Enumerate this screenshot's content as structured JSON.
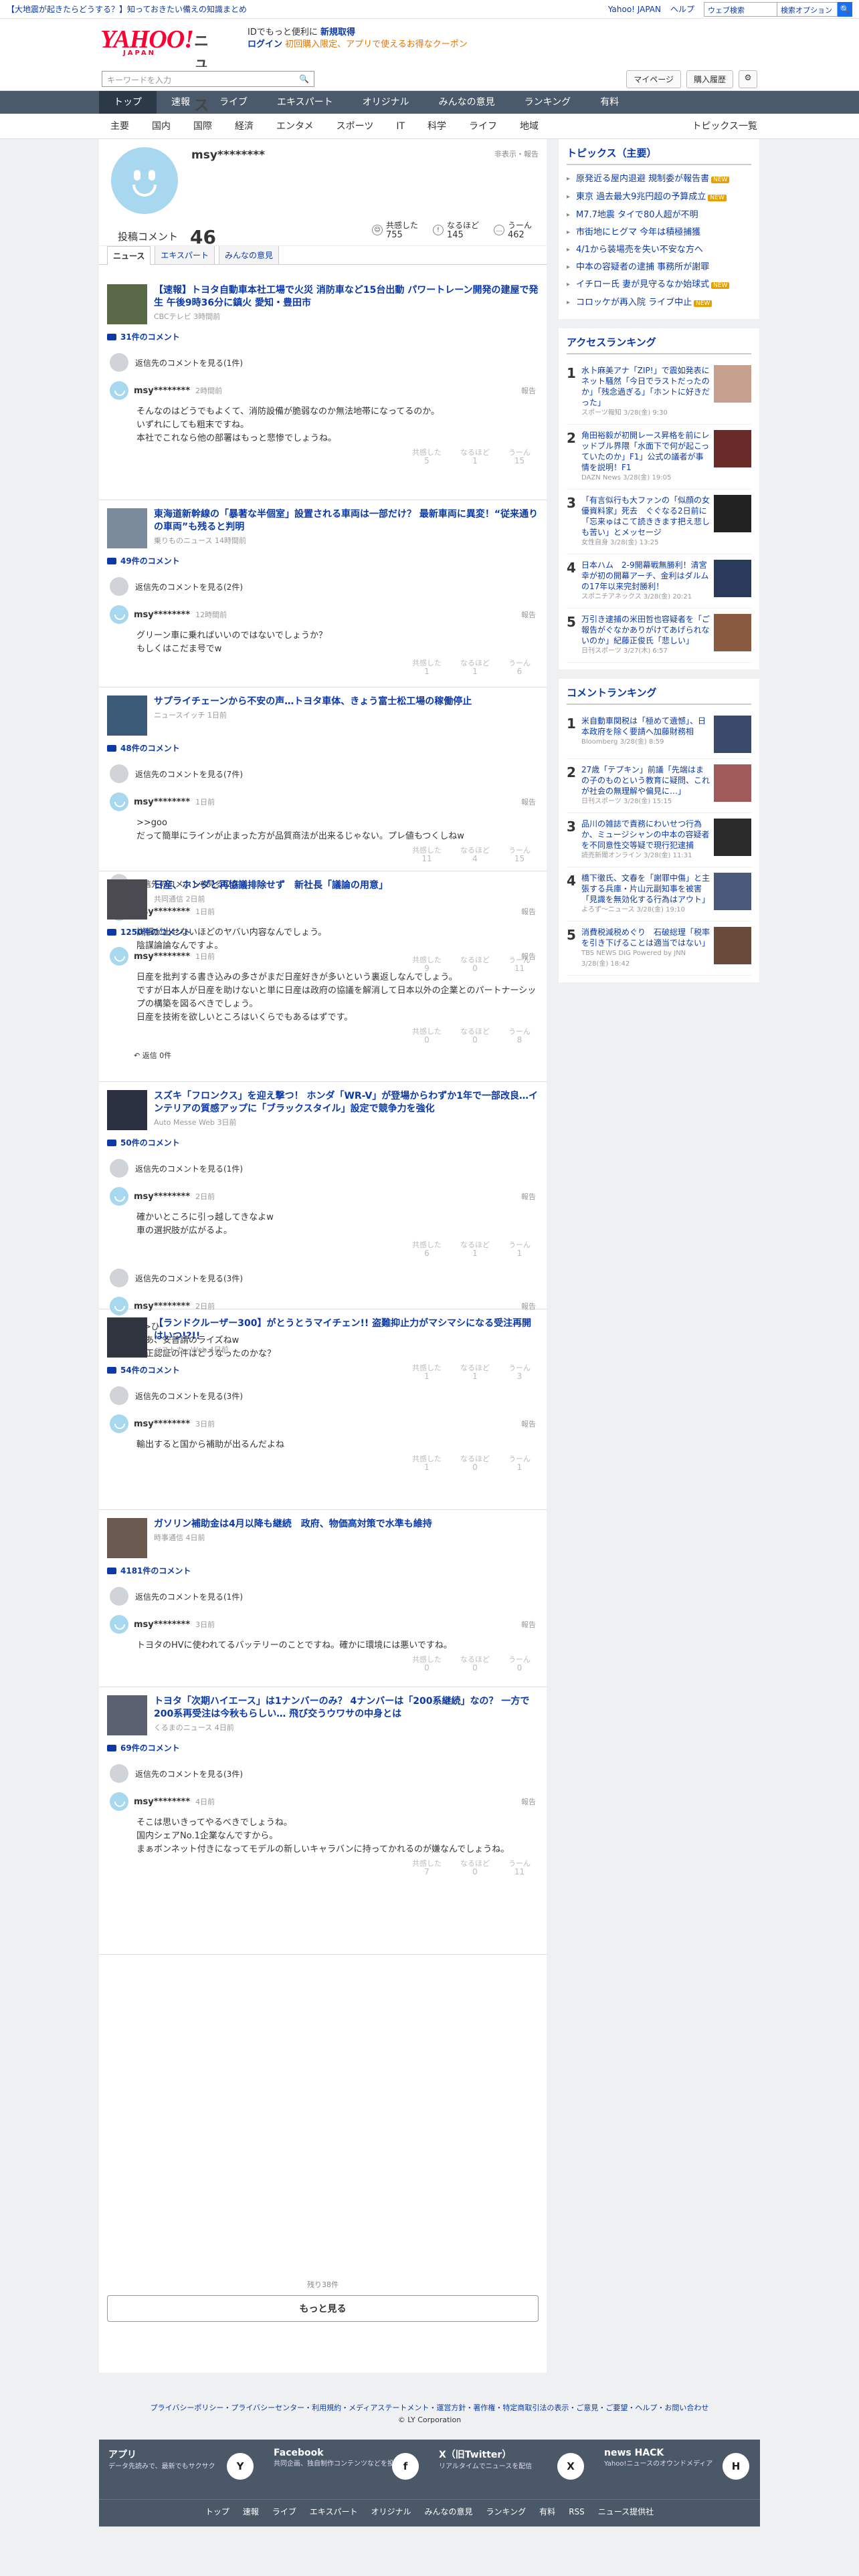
{
  "topbar": {
    "promo": "【大地震が起きたらどうする？】知っておきたい備えの知識まとめ",
    "yahoo_japan": "Yahoo! JAPAN",
    "help": "ヘルプ",
    "search_placeholder": "ウェブ検索",
    "search_value": "検索オプション",
    "search_btn": "🔍"
  },
  "header": {
    "logo": "YAHOO!",
    "logo_sub": "JAPAN",
    "service": "ニュース",
    "msg1": "IDでもっと便利に",
    "msg1_link": "新規取得",
    "login": "ログイン",
    "coupon": "初回購入限定、アプリで使えるお得なクーポン",
    "keyword_placeholder": "キーワードを入力",
    "mypage": "マイページ",
    "history": "購入履歴",
    "gear": "⚙"
  },
  "gnav": [
    "トップ",
    "速報",
    "ライブ",
    "エキスパート",
    "オリジナル",
    "みんなの意見",
    "ランキング",
    "有料"
  ],
  "snav": [
    "主要",
    "国内",
    "国際",
    "経済",
    "エンタメ",
    "スポーツ",
    "IT",
    "科学",
    "ライフ",
    "地域"
  ],
  "snav_all": "トピックス一覧",
  "profile": {
    "name": "msy********",
    "report": "非表示・報告",
    "count_label": "投稿コメント",
    "count": "46",
    "stats": [
      {
        "label": "共感した",
        "num": "755",
        "ic": "☺"
      },
      {
        "label": "なるほど",
        "num": "145",
        "ic": "!"
      },
      {
        "label": "うーん",
        "num": "462",
        "ic": "…"
      }
    ]
  },
  "tabs": [
    "ニュース",
    "エキスパート",
    "みんなの意見"
  ],
  "articles": [
    {
      "title": "【速報】トヨタ自動車本社工場で火災 消防車など15台出動 パワートレーン開発の建屋で発生 午後9時36分に鎮火 愛知・豊田市",
      "src": "CBCテレビ 3時間前",
      "count": "31件のコメント",
      "orig": "返信先のコメントを見る(1件)",
      "user": "msy********",
      "time": "2時間前",
      "text": "そんなのはどうでもよくて、消防設備が脆弱なのか無法地帯になってるのか。\nいずれにしても粗末ですね。\n本社でこれなら他の部署はもっと悲惨でしょうね。",
      "r": [
        "5",
        "1",
        "15"
      ],
      "thumb": "#5a6a48"
    },
    {
      "title": "東海道新幹線の「暴著な半個室」設置される車両は一部だけ？ 最新車両に異変！“従来通りの車両”も残ると判明",
      "src": "乗りものニュース 14時間前",
      "count": "49件のコメント",
      "orig": "返信先のコメントを見る(2件)",
      "user": "msy********",
      "time": "12時間前",
      "text": "グリーン車に乗ればいいのではないでしょうか？\nもしくはこだま号でw",
      "r": [
        "1",
        "1",
        "6"
      ],
      "thumb": "#7a8a9a"
    },
    {
      "title": "サプライチェーンから不安の声…トヨタ車体、きょう富士松工場の稼働停止",
      "src": "ニュースイッチ 1日前",
      "count": "48件のコメント",
      "orig": "返信先のコメントを見る(7件)",
      "user": "msy********",
      "time": "1日前",
      "text": ">>goo\nだって簡単にラインが止まった方が品質商法が出来るじゃない。プレ値もつくしねw",
      "r": [
        "11",
        "4",
        "15"
      ],
      "thumb": "#3a5a78",
      "user2": "msy********",
      "time2": "1日前",
      "orig2": "返信先のコメントを見る(2件)",
      "text2": "詳細が出せないほどのヤバい内容なんでしょう。\n陰謀論論なんですよ。",
      "r2": [
        "9",
        "0",
        "11"
      ]
    },
    {
      "title": "日産、ホンダと再協議排除せず　新社長「議論の用意」",
      "src": "共同通信 2日前",
      "count": "1250件のコメント",
      "user": "msy********",
      "time": "1日前",
      "text": "日産を批判する書き込みの多さがまだ日産好きが多いという裏返しなんでしょう。\nですが日本人が日産を助けないと単に日産は政府の協議を解消して日本以外の企業とのパートナーシップの構築を図るべきでしょう。\n日産を技術を欲しいところはいくらでもあるはずです。",
      "r": [
        "0",
        "0",
        "8"
      ],
      "reply": "返信 0件",
      "thumb": "#4a4a50"
    },
    {
      "title": "スズキ「フロンクス」を迎え撃つ！ ホンダ「WR-V」が登場からわずか1年で一部改良…インテリアの質感アップに「ブラックスタイル」設定で競争力を強化",
      "src": "Auto Messe Web 3日前",
      "count": "50件のコメント",
      "orig": "返信先のコメントを見る(1件)",
      "user": "msy********",
      "time": "2日前",
      "text": "確かいところに引っ越してきなよw\n車の選択肢が広がるよ。",
      "r": [
        "6",
        "1",
        "1"
      ],
      "thumb": "#2a3040",
      "user2": "msy********",
      "time2": "2日前",
      "orig2": "返信先のコメントを見る(3件)",
      "text2": ">>ひ\nああ、安普請のライズねw\n不正認証の件はどうなったのかな？",
      "r2": [
        "1",
        "1",
        "3"
      ]
    },
    {
      "title": "【ランドクルーザー300】がとうとうマイチェン!! 盗難抑止力がマシマシになる受注再開はいつ!?!!",
      "src": "ベストカーWeb 4日前",
      "count": "54件のコメント",
      "orig": "返信先のコメントを見る(3件)",
      "user": "msy********",
      "time": "3日前",
      "text": "輸出すると国から補助が出るんだよね",
      "r": [
        "1",
        "0",
        "1"
      ],
      "thumb": "#303540"
    },
    {
      "title": "ガソリン補助金は4月以降も継続　政府、物価高対策で水準も維持",
      "src": "時事通信 4日前",
      "count": "4181件のコメント",
      "orig": "返信先のコメントを見る(1件)",
      "user": "msy********",
      "time": "3日前",
      "text": "トヨタのHVに使われてるバッテリーのことですね。確かに環境には悪いですね。",
      "r": [
        "0",
        "0",
        "0"
      ],
      "thumb": "#6a5a50"
    },
    {
      "title": "トヨタ「次期ハイエース」は1ナンバーのみ？ 4ナンバーは「200系継続」なの？ 一方で200系再受注は今秋もらしい… 飛び交うウワサの中身とは",
      "src": "くるまのニュース 4日前",
      "count": "69件のコメント",
      "orig": "返信先のコメントを見る(3件)",
      "user": "msy********",
      "time": "4日前",
      "text": "そこは思いきってやるべきでしょうね。\n国内シェアNo.1企業なんですから。\nまぁボンネット付きになってモデルの新しいキャラバンに持ってかれるのが嫌なんでしょうね。",
      "r": [
        "7",
        "0",
        "11"
      ],
      "thumb": "#5a6070"
    }
  ],
  "more": {
    "remain": "残り38件",
    "button": "もっと見る"
  },
  "topics": {
    "title": "トピックス（主要）",
    "items": [
      {
        "t": "原発近る屋内退避 規制委が報告書",
        "n": "NEW"
      },
      {
        "t": "東京 過去最大9兆円超の予算成立",
        "n": "NEW"
      },
      {
        "t": "M7.7地震 タイで80人超が不明",
        "n": ""
      },
      {
        "t": "市街地にヒグマ 今年は積極捕獲",
        "n": ""
      },
      {
        "t": "4/1から装場売を失い不安な方へ",
        "n": ""
      },
      {
        "t": "中本の容疑者の逮捕 事務所が謝罪",
        "n": ""
      },
      {
        "t": "イチロー氏 妻が見守るなか始球式",
        "n": "NEW"
      },
      {
        "t": "コロッケが再入院 ライブ中止",
        "n": "NEW"
      }
    ]
  },
  "access": {
    "title": "アクセスランキング",
    "items": [
      {
        "no": "1",
        "t": "水卜麻美アナ「ZIP!」で震如発表にネット騒然「今日でラストだったのか」「残念過ぎる」「ホントに好きだった」",
        "s": "スポーツ報知 3/28(金) 9:30",
        "c": "#c8a090"
      },
      {
        "no": "2",
        "t": "角田裕毅が初開レース昇格を前にレッドブル界隈「水面下で何が起こっていたのか」F1」公式の議者が事情を説明！F1",
        "s": "DAZN News 3/28(金) 19:05",
        "c": "#6a2a2a"
      },
      {
        "no": "3",
        "t": "「有言似行も大ファンの「似顔の女優資料家」死去　ぐぐなる2日前に「忘来ゅはこて読ききます把え悲しも苦い」とメッセージ",
        "s": "女性自身 3/28(金) 13:25",
        "c": "#222"
      },
      {
        "no": "4",
        "t": "日本ハム　2-9開幕戦無勝利！清宮幸が初の開幕アーチ、金利はダルムの17年以来完封勝利！",
        "s": "スポニチアネックス 3/28(金) 20:21",
        "c": "#2a3a5a"
      },
      {
        "no": "5",
        "t": "万引き逮捕の米田哲也容疑者を「ご報告がぐなかありがけてあげられないのか」紀藤正俊氏「悲しい」",
        "s": "日刊スポーツ 3/27(木) 6:57",
        "c": "#8a5a40"
      }
    ]
  },
  "comment_rank": {
    "title": "コメントランキング",
    "items": [
      {
        "no": "1",
        "t": "米自動車関税は「極めて遺憾」、日本政府を除く要請へ加藤財務相",
        "s": "Bloomberg 3/28(金) 8:59",
        "c": "#3a4a6a"
      },
      {
        "no": "2",
        "t": "27歳「テプキン」前議「先端はまの子のものという教育に疑問、これが社会の無理解や偏見に…」",
        "s": "日刊スポーツ 3/28(金) 15:15",
        "c": "#a05a5a"
      },
      {
        "no": "3",
        "t": "品川の雑誌で責務にわいせつ行為か、ミュージシャンの中本の容疑者を不同意性交等疑で現行犯逮捕",
        "s": "読売新聞オンライン 3/28(金) 11:31",
        "c": "#2a2a2a"
      },
      {
        "no": "4",
        "t": "橋下徹氏、文春を「謝罪中傷」と主張する兵庫・片山元副知事を被害「見識を無効化する行為はアウト」",
        "s": "よろず〜ニュース 3/28(金) 19:10",
        "c": "#4a5a7a"
      },
      {
        "no": "5",
        "t": "消費税減税めぐり　石破総理「税率を引き下げることは適当ではない」",
        "s": "TBS NEWS DIG Powered by JNN 3/28(金) 18:42",
        "c": "#6a4a3a"
      }
    ]
  },
  "footer": {
    "apps": [
      {
        "n": "アプリ",
        "d": "データ先読みで、最新でもサクサク",
        "i": "Y"
      },
      {
        "n": "Facebook",
        "d": "共同企画、独自制作コンテンツなどを投稿",
        "i": "f"
      },
      {
        "n": "X（旧Twitter）",
        "d": "リアルタイムでニュースを配信",
        "i": "X"
      },
      {
        "n": "news HACK",
        "d": "Yahoo!ニュースのオウンドメディア",
        "i": "H"
      }
    ],
    "links": [
      "トップ",
      "速報",
      "ライブ",
      "エキスパート",
      "オリジナル",
      "みんなの意見",
      "ランキング",
      "有料",
      "RSS",
      "ニュース提供社"
    ]
  },
  "legal": {
    "links": "プライバシーポリシー・プライバシーセンター・利用規約・メディアステートメント・運営方針・著作権・特定商取引法の表示・ご意見・ご要望・ヘルプ・お問い合わせ",
    "copy": "© LY Corporation"
  }
}
